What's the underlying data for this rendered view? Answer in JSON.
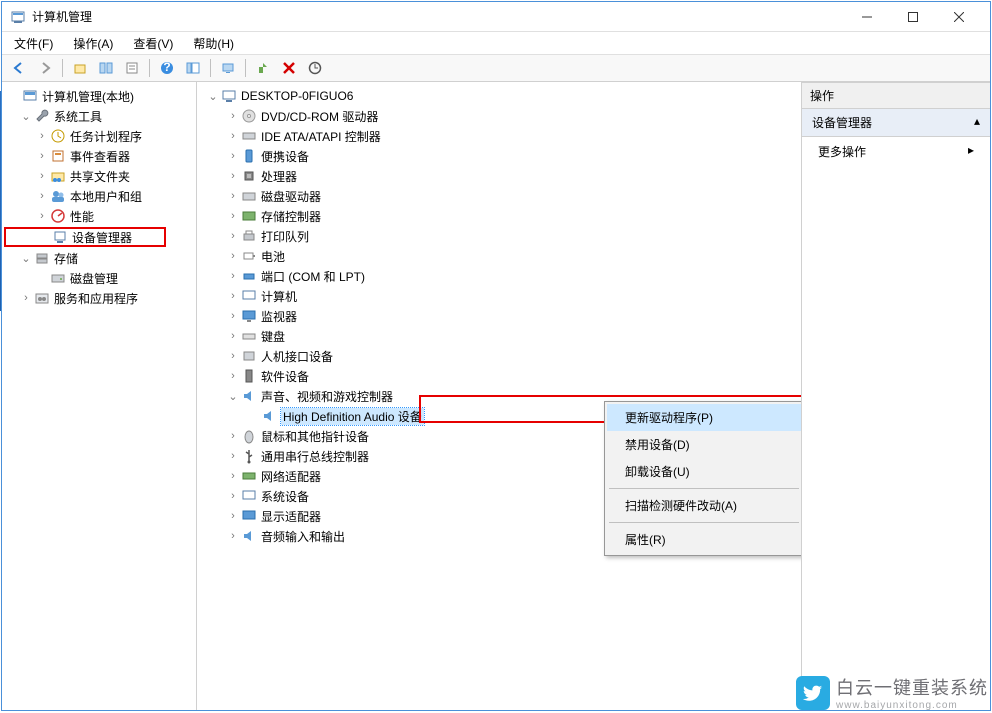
{
  "window": {
    "title": "计算机管理"
  },
  "menu": {
    "file": "文件(F)",
    "action": "操作(A)",
    "view": "查看(V)",
    "help": "帮助(H)"
  },
  "left_tree": {
    "root": "计算机管理(本地)",
    "systools": "系统工具",
    "task": "任务计划程序",
    "event": "事件查看器",
    "shared": "共享文件夹",
    "users": "本地用户和组",
    "perf": "性能",
    "devmgr": "设备管理器",
    "storage": "存储",
    "diskmgr": "磁盘管理",
    "services": "服务和应用程序"
  },
  "mid_tree": {
    "root": "DESKTOP-0FIGUO6",
    "dvd": "DVD/CD-ROM 驱动器",
    "ide": "IDE ATA/ATAPI 控制器",
    "portable": "便携设备",
    "cpu": "处理器",
    "disk": "磁盘驱动器",
    "storage": "存储控制器",
    "printq": "打印队列",
    "battery": "电池",
    "ports": "端口 (COM 和 LPT)",
    "computer": "计算机",
    "monitor": "监视器",
    "keyboard": "键盘",
    "hid": "人机接口设备",
    "software": "软件设备",
    "audio": "声音、视频和游戏控制器",
    "audio_item": "High Definition Audio 设备",
    "mouse": "鼠标和其他指针设备",
    "usb": "通用串行总线控制器",
    "network": "网络适配器",
    "system": "系统设备",
    "display": "显示适配器",
    "audioio": "音频输入和输出"
  },
  "ctx": {
    "update": "更新驱动程序(P)",
    "disable": "禁用设备(D)",
    "uninstall": "卸载设备(U)",
    "scan": "扫描检测硬件改动(A)",
    "props": "属性(R)"
  },
  "actions": {
    "header": "操作",
    "devmgr": "设备管理器",
    "more": "更多操作"
  },
  "wm": {
    "line1": "白云一键重装系统",
    "line2": "www.baiyunxitong.com"
  }
}
